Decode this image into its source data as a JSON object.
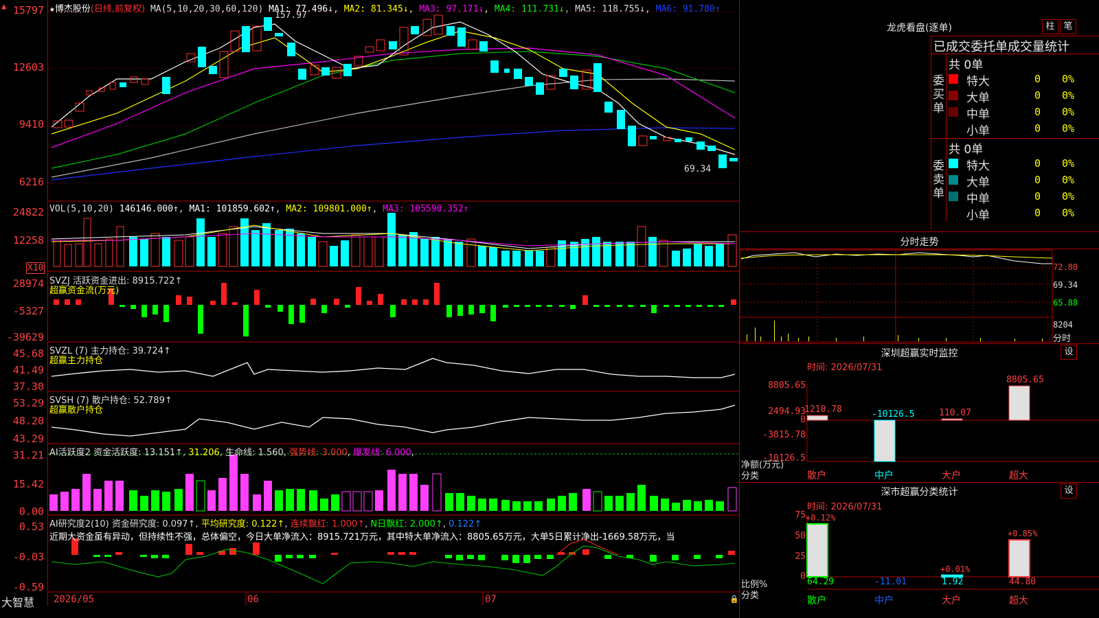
{
  "main": {
    "stock_name": "博杰股份",
    "period": "(日线,前复权)",
    "ma_params": "MA(5,10,20,30,60,120)",
    "ma1": "MA1: 77.496↓",
    "ma2": "MA2: 81.345↓",
    "ma3": "MA3: 97.171↓",
    "ma4": "MA4: 111.731↓",
    "ma5": "MA5: 118.755↓",
    "ma6": "MA6: 91.780↑",
    "high_mark": "157.97",
    "low_mark": "69.34",
    "yticks": [
      "15797",
      "12603",
      "9410",
      "6216"
    ]
  },
  "vol": {
    "title": "VOL(5,10,20)",
    "value": "146146.000↑",
    "ma1": "MA1: 101859.602↑",
    "ma2": "MA2: 109801.000↑",
    "ma3": "MA3: 105590.352↑",
    "yticks": [
      "24822",
      "12258"
    ],
    "unit": "X10"
  },
  "svzj": {
    "title": "SVZJ  活跃资金进出: 8915.722↑",
    "subtitle": "超赢资金流(万元)",
    "yticks": [
      "28974",
      "-5327",
      "-39629"
    ]
  },
  "svzl": {
    "title": "SVZL (7) 主力持仓: 39.724↑",
    "subtitle": "超赢主力持仓",
    "yticks": [
      "45.68",
      "41.49",
      "37.30"
    ]
  },
  "svsh": {
    "title": "SVSH (7) 散户持仓: 52.789↑",
    "subtitle": "超赢散户持仓",
    "yticks": [
      "53.29",
      "48.20",
      "43.29"
    ]
  },
  "ai1": {
    "title": "AI活跃度2 资金活跃度: 13.151↑",
    "v2": "31.206",
    "life": "生命线: 1.560",
    "strong": "强势线: 3.000",
    "burst": "爆发线: 6.000",
    "yticks": [
      "31.21",
      "15.42",
      "0.00"
    ]
  },
  "ai2": {
    "title": "AI研究度2(10) 资金研究度: 0.097↑",
    "avg": "平均研究度: 0.122↑",
    "cont": "连续飘红: 1.000↑",
    "nday": "N日飘红: 2.000↑",
    "v": "0.122↑",
    "comment": "近期大资金虽有异动，但持续性不强，总体偏空，今日大单净流入：8915.721万元，其中特大单净流入：8805.65万元，大单5日累计净出-1669.58万元，当",
    "yticks": [
      "0.53",
      "-0.03",
      "-0.59"
    ]
  },
  "xaxis": {
    "labels": [
      "2026/05",
      "06",
      "07"
    ]
  },
  "brand": "大智慧",
  "right": {
    "lhb_title": "龙虎看盘(逐单)",
    "btn1": "柱",
    "btn2": "笔",
    "header": "已成交委托单成交量统计",
    "buy_label": "委买单",
    "sell_label": "委卖单",
    "buy_total": "共 0单",
    "sell_total": "共 0单",
    "buy_rows": [
      {
        "name": "特大",
        "n": "0",
        "pct": "0%",
        "color": "#ff0000"
      },
      {
        "name": "大单",
        "n": "0",
        "pct": "0%",
        "color": "#8b0000"
      },
      {
        "name": "中单",
        "n": "0",
        "pct": "0%",
        "color": "#6b0000"
      },
      {
        "name": "小单",
        "n": "0",
        "pct": "0%",
        "color": "#000000"
      }
    ],
    "sell_rows": [
      {
        "name": "特大",
        "n": "0",
        "pct": "0%",
        "color": "#00ffff"
      },
      {
        "name": "大单",
        "n": "0",
        "pct": "0%",
        "color": "#008b8b"
      },
      {
        "name": "中单",
        "n": "0",
        "pct": "0%",
        "color": "#007070"
      },
      {
        "name": "小单",
        "n": "0",
        "pct": "0%",
        "color": "#000000"
      }
    ],
    "intraday_title": "分时走势",
    "intraday_ticks": [
      "72.80",
      "69.34",
      "65.88",
      "8204",
      "分时"
    ],
    "monitor_title": "深圳超赢实时监控",
    "monitor_btn": "设",
    "monitor_time": "时间: 2026/07/31",
    "monitor_yticks": [
      "8805.65",
      "2494.93",
      "0",
      "-3815.78",
      "-10126.5"
    ],
    "monitor_ylabel": "净额(万元)",
    "monitor_xlabel": "分类",
    "monitor_bars": [
      {
        "cat": "散户",
        "label": "1210.78",
        "value": 1210.78,
        "color": "#ff4040"
      },
      {
        "cat": "中户",
        "label": "-10126.5",
        "value": -10126.5,
        "color": "#00ffff"
      },
      {
        "cat": "大户",
        "label": "110.07",
        "value": 110.07,
        "color": "#ff4040"
      },
      {
        "cat": "超大",
        "label": "8805.65",
        "value": 8805.65,
        "color": "#ff4040"
      }
    ],
    "stat_title": "深市超赢分类统计",
    "stat_btn": "设",
    "stat_time": "时间: 2026/07/31",
    "stat_yticks": [
      "75",
      "50",
      "25",
      "0"
    ],
    "stat_ylabel": "比例%",
    "stat_xlabel": "分类",
    "stat_bars": [
      {
        "cat": "散户",
        "top": "+0.12%",
        "bottom": "64.29",
        "value": 64.29,
        "color": "#00ff00"
      },
      {
        "cat": "中户",
        "top": "",
        "bottom": "-11.01",
        "value": 0,
        "color": "#0000ff"
      },
      {
        "cat": "大户",
        "top": "+0.01%",
        "bottom": "1.92",
        "value": 1.92,
        "color": "#00ffff"
      },
      {
        "cat": "超大",
        "top": "+0.85%",
        "bottom": "44.80",
        "value": 44.8,
        "color": "#ff4040"
      }
    ]
  }
}
